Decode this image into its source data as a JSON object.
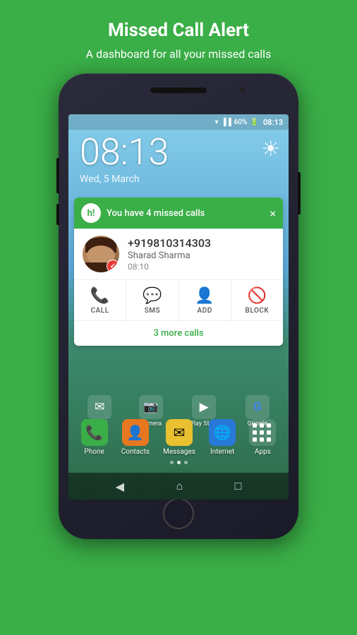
{
  "header": {
    "title": "Missed Call Alert",
    "subtitle": "A dashboard for all your missed calls"
  },
  "status_bar": {
    "time": "08:13",
    "battery": "60%",
    "wifi": "wifi-icon",
    "signal": "signal-icon"
  },
  "lock_screen": {
    "time": "08:13",
    "date": "Wed, 5 March"
  },
  "notification": {
    "app_icon_label": "h!",
    "message": "You have 4 missed calls",
    "close_label": "×"
  },
  "contact": {
    "number": "+919810314303",
    "name": "Sharad Sharma",
    "time": "08:10",
    "missed_count": "✓"
  },
  "actions": [
    {
      "icon": "📞",
      "label": "CALL"
    },
    {
      "icon": "💬",
      "label": "SMS"
    },
    {
      "icon": "👤",
      "label": "ADD"
    },
    {
      "icon": "🚫",
      "label": "BLOCK"
    }
  ],
  "more_calls": {
    "label": "3 more calls"
  },
  "mini_apps": [
    {
      "label": "Email",
      "bg": "#555",
      "icon": "✉"
    },
    {
      "label": "Camera",
      "bg": "#555",
      "icon": "📷"
    },
    {
      "label": "Play Store",
      "bg": "#555",
      "icon": "▶"
    },
    {
      "label": "Google",
      "bg": "#555",
      "icon": "G"
    }
  ],
  "dock": [
    {
      "label": "Phone",
      "bg": "#3aae47",
      "icon": "📞"
    },
    {
      "label": "Contacts",
      "bg": "#e87722",
      "icon": "👤"
    },
    {
      "label": "Messages",
      "bg": "#f0c030",
      "icon": "✉"
    },
    {
      "label": "Internet",
      "bg": "#2878d8",
      "icon": "🌐"
    },
    {
      "label": "Apps",
      "bg": "#555",
      "icon": "⠿"
    }
  ],
  "nav": {
    "back": "◀",
    "home": "⌂",
    "recent": "□"
  }
}
